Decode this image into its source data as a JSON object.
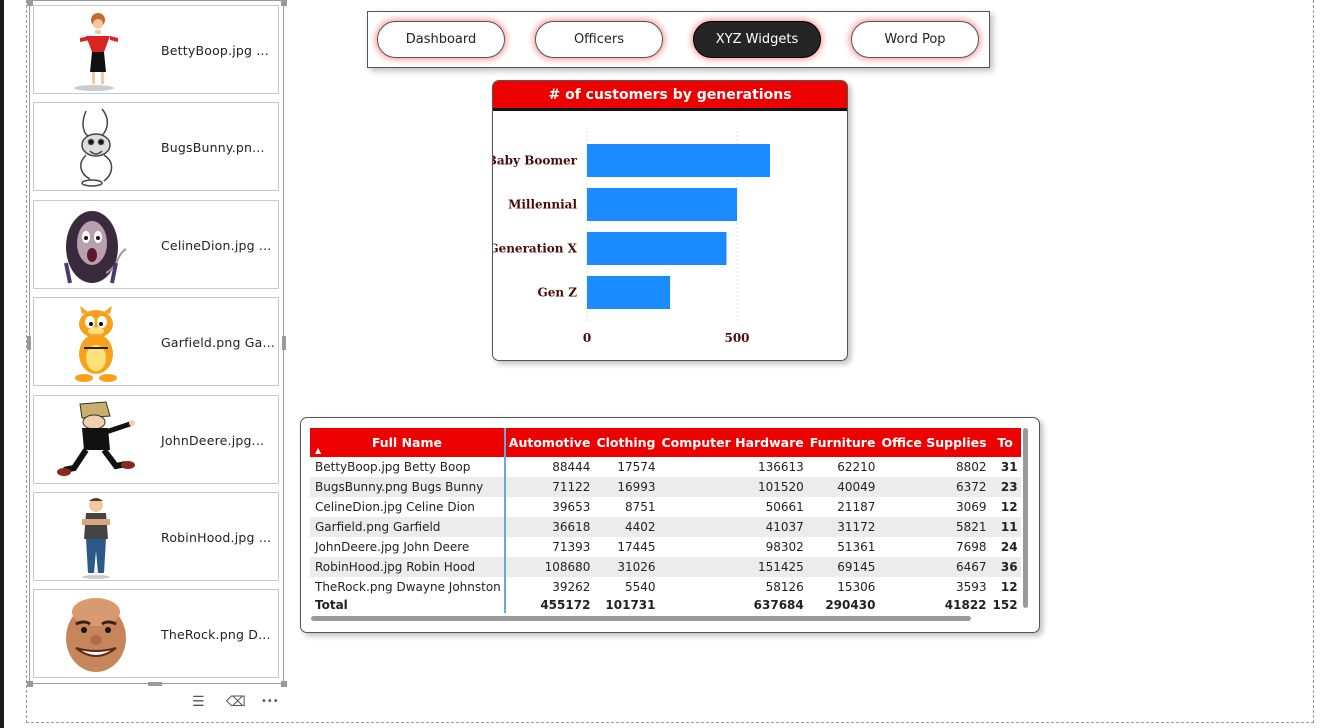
{
  "slicer": {
    "items": [
      {
        "label": "BettyBoop.jpg ...",
        "icon": "betty-boop-image"
      },
      {
        "label": "BugsBunny.pn...",
        "icon": "bugs-bunny-image"
      },
      {
        "label": "CelineDion.jpg ...",
        "icon": "celine-dion-caricature-image"
      },
      {
        "label": "Garfield.png Ga...",
        "icon": "garfield-image"
      },
      {
        "label": "JohnDeere.jpg...",
        "icon": "john-deere-cartoon-image"
      },
      {
        "label": "RobinHood.jpg ...",
        "icon": "robin-hood-cartoon-image"
      },
      {
        "label": "TheRock.png D...",
        "icon": "the-rock-caricature-image"
      }
    ]
  },
  "footer": {
    "filter_icon": "☰",
    "eraser_icon": "⌫",
    "more_icon": "•••"
  },
  "nav": {
    "buttons": [
      {
        "label": "Dashboard",
        "active": false
      },
      {
        "label": "Officers",
        "active": false
      },
      {
        "label": "XYZ Widgets",
        "active": true
      },
      {
        "label": "Word Pop",
        "active": false
      }
    ]
  },
  "chart": {
    "title": "# of customers by generations"
  },
  "chart_data": {
    "type": "bar",
    "orientation": "horizontal",
    "categories": [
      "Baby Boomer",
      "Millennial",
      "Generation X",
      "Gen Z"
    ],
    "values": [
      610,
      500,
      465,
      277
    ],
    "xlim": [
      0,
      600
    ],
    "xticks": [
      "0",
      "500"
    ],
    "color": "#1a8cff",
    "label_color": "#4a0a0a",
    "grid": true
  },
  "table": {
    "columns": [
      "Full Name",
      "Automotive",
      "Clothing",
      "Computer Hardware",
      "Furniture",
      "Office Supplies",
      "To"
    ],
    "rows": [
      [
        "BettyBoop.jpg Betty Boop",
        "88444",
        "17574",
        "136613",
        "62210",
        "8802",
        "31"
      ],
      [
        "BugsBunny.png Bugs Bunny",
        "71122",
        "16993",
        "101520",
        "40049",
        "6372",
        "23"
      ],
      [
        "CelineDion.jpg Celine Dion",
        "39653",
        "8751",
        "50661",
        "21187",
        "3069",
        "12"
      ],
      [
        "Garfield.png Garfield",
        "36618",
        "4402",
        "41037",
        "31172",
        "5821",
        "11"
      ],
      [
        "JohnDeere.jpg John Deere",
        "71393",
        "17445",
        "98302",
        "51361",
        "7698",
        "24"
      ],
      [
        "RobinHood.jpg Robin Hood",
        "108680",
        "31026",
        "151425",
        "69145",
        "6467",
        "36"
      ],
      [
        "TheRock.png Dwayne Johnston",
        "39262",
        "5540",
        "58126",
        "15306",
        "3593",
        "12"
      ]
    ],
    "total": [
      "Total",
      "455172",
      "101731",
      "637684",
      "290430",
      "41822",
      "152"
    ],
    "sort_indicator": "▲"
  },
  "colors": {
    "accent_red": "#ef0000",
    "bar_blue": "#1a8cff",
    "dark_button": "#252525"
  }
}
